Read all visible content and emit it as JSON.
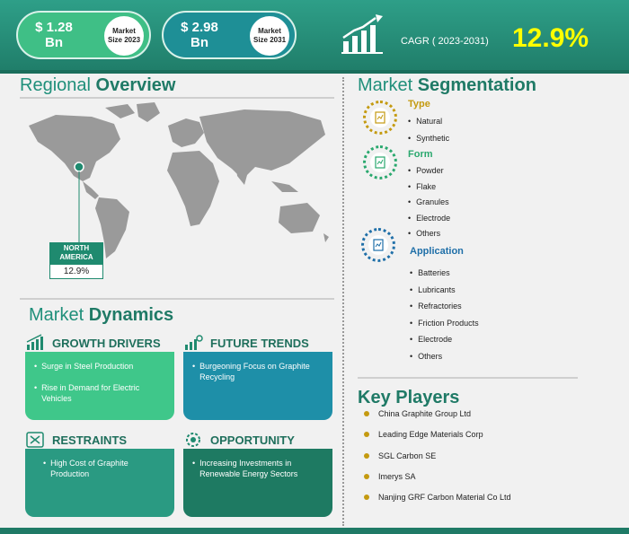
{
  "header": {
    "market2023": {
      "value": "$ 1.28\nBn",
      "label": "Market Size 2023"
    },
    "market2031": {
      "value": "$ 2.98\nBn",
      "label": "Market Size 2031"
    },
    "cagr_label": "CAGR ( 2023-2031)",
    "cagr_value": "12.9%"
  },
  "regional": {
    "title_light": "Regional ",
    "title_bold": "Overview",
    "region_name": "NORTH AMERICA",
    "region_value": "12.9%"
  },
  "dynamics": {
    "title_light": "Market ",
    "title_bold": "Dynamics",
    "growth_drivers": {
      "title": "GROWTH DRIVERS",
      "items": [
        "Surge in Steel Production",
        "Rise in Demand for Electric Vehicles"
      ]
    },
    "future_trends": {
      "title": "FUTURE TRENDS",
      "items": [
        "Burgeoning Focus on Graphite Recycling"
      ]
    },
    "restraints": {
      "title": "RESTRAINTS",
      "items": [
        "High Cost of Graphite Production"
      ]
    },
    "opportunity": {
      "title": "OPPORTUNITY",
      "items": [
        "Increasing Investments in Renewable Energy Sectors"
      ]
    }
  },
  "segmentation": {
    "title_light": "Market ",
    "title_bold": "Segmentation",
    "type": {
      "title": "Type",
      "items": [
        "Natural",
        "Synthetic"
      ]
    },
    "form": {
      "title": "Form",
      "items": [
        "Powder",
        "Flake",
        "Granules",
        "Electrode",
        "Others"
      ]
    },
    "application": {
      "title": "Application",
      "items": [
        "Batteries",
        "Lubricants",
        "Refractories",
        "Friction Products",
        "Electrode",
        "Others"
      ]
    }
  },
  "key_players": {
    "title": "Key Players",
    "items": [
      "China Graphite Group Ltd",
      "Leading Edge Materials Corp",
      "SGL Carbon SE",
      "Imerys SA",
      "Nanjing GRF Carbon Material Co Ltd"
    ]
  },
  "colors": {
    "header": "#2e9f88",
    "accent_green": "#3fbf86",
    "teal": "#1e8f96",
    "cagr_yellow": "#ffff00",
    "type_gold": "#c49a10",
    "form_green": "#2aa86e",
    "application_blue": "#1f6fa8"
  },
  "icons": [
    "bar-chart-icon",
    "growth-chart-icon",
    "trend-icon",
    "restraint-icon",
    "opportunity-icon",
    "document-icon"
  ]
}
